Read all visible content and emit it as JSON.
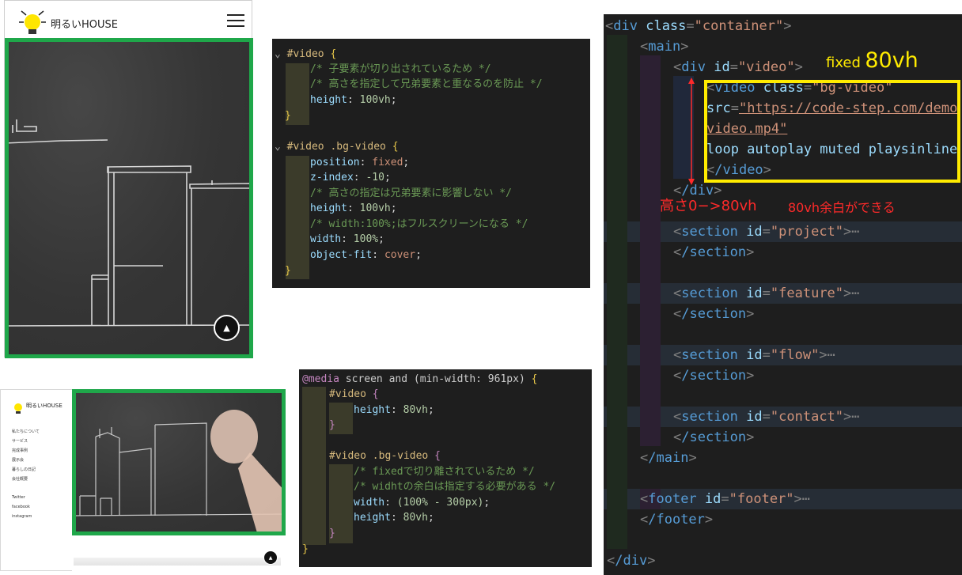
{
  "mobile": {
    "brand": "明るいHOUSE"
  },
  "desktop": {
    "brand": "明るいHOUSE",
    "nav": [
      "私たちについて",
      "サービス",
      "完成事例",
      "展示会",
      "暮らしの日記",
      "会社概要"
    ],
    "social": [
      "Twitter",
      "facebook",
      "instagram"
    ]
  },
  "css_code_1": {
    "lines": [
      {
        "sel": "#video",
        "brace": "{"
      },
      {
        "cmt": "/* 子要素が切り出されているため */"
      },
      {
        "cmt": "/* 高さを指定して兄弟要素と重なるのを防止 */"
      },
      {
        "prop": "height",
        "val": "100vh"
      },
      {
        "brace": "}"
      },
      {
        "sel": "#video .bg-video",
        "brace": "{"
      },
      {
        "prop": "position",
        "val": "fixed"
      },
      {
        "prop": "z-index",
        "val": "-10"
      },
      {
        "cmt": "/* 高さの指定は兄弟要素に影響しない */"
      },
      {
        "prop": "height",
        "val": "100vh"
      },
      {
        "cmt": "/* width:100%;はフルスクリーンになる */"
      },
      {
        "prop": "width",
        "val": "100%"
      },
      {
        "prop": "object-fit",
        "val": "cover"
      },
      {
        "brace": "}"
      }
    ]
  },
  "css_code_2": {
    "media_kw": "@media",
    "media_rest": "screen and (min-width: 961px)",
    "media_brace": "{",
    "sel1": "#video",
    "p1": "height",
    "v1": "80vh",
    "sel2": "#video .bg-video",
    "c1": "/* fixedで切り離されているため */",
    "c2": "/* widhtの余白は指定する必要がある */",
    "p2": "width",
    "v2": "(100% - 300px)",
    "p3": "height",
    "v3": "80vh",
    "open": "{",
    "close": "}"
  },
  "html_code": {
    "l1_tag": "div",
    "l1_attr": "class",
    "l1_val": "\"container\"",
    "l2_tag": "main",
    "l3_tag": "div",
    "l3_attr": "id",
    "l3_val": "\"video\"",
    "l4_tag": "video",
    "l4_attr": "class",
    "l4_val": "\"bg-video\"",
    "l5_attr": "src",
    "l5_val": "\"https://code-step.com/demo",
    "l6_val": "video.mp4\"",
    "l7_txt": "loop autoplay muted playsinline",
    "l8_tag": "/video",
    "l9_tag": "/div",
    "sections": [
      "project",
      "feature",
      "flow",
      "contact"
    ],
    "section_tag": "section",
    "section_close": "/section",
    "main_close": "/main",
    "footer_tag": "footer",
    "footer_attr": "id",
    "footer_val": "\"footer\"",
    "footer_close": "/footer",
    "div_close": "/div",
    "ellipsis": "⋯"
  },
  "annotations": {
    "fixed_label": "fixed",
    "fixed_value": "80vh",
    "height_note": "高さ0−>80vh",
    "gap_note": "80vh余白ができる"
  },
  "colors": {
    "green_frame": "#1fa74a",
    "yellow_box": "#ffeb00",
    "red_note": "#ff2a2a"
  }
}
